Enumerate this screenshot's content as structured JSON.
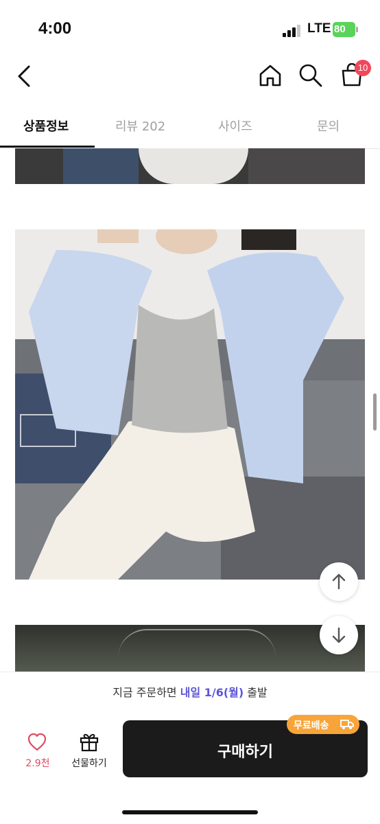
{
  "status_bar": {
    "time": "4:00",
    "network": "LTE",
    "battery": "80"
  },
  "nav": {
    "cart_badge": "10"
  },
  "tabs": [
    {
      "label": "상품정보",
      "active": true
    },
    {
      "label": "리뷰 202",
      "active": false
    },
    {
      "label": "사이즈",
      "active": false
    },
    {
      "label": "문의",
      "active": false
    }
  ],
  "shipping": {
    "prefix": "지금 주문하면 ",
    "highlight": "내일 1/6(월)",
    "suffix": " 출발"
  },
  "bottom": {
    "wish_count": "2.9천",
    "gift_label": "선물하기",
    "buy_label": "구매하기",
    "free_shipping_badge": "무료배송"
  },
  "colors": {
    "accent": "#5b55d9",
    "heart": "#e04a62",
    "badge": "#f0485b",
    "free_badge": "#f7a53a",
    "buy_button": "#1b1b1b"
  }
}
